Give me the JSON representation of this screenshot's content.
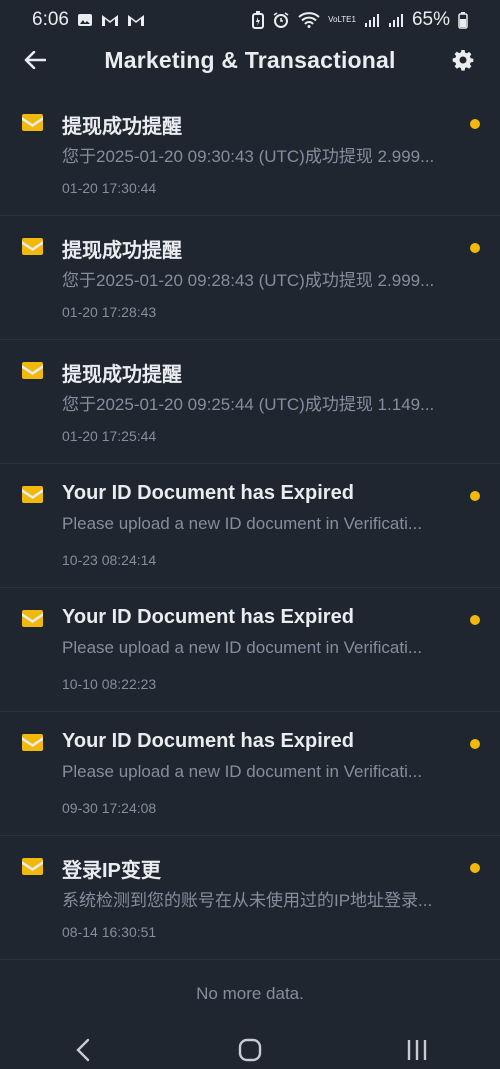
{
  "status_bar": {
    "time": "6:06",
    "battery": "65%",
    "network": "VoLTE1"
  },
  "header": {
    "title": "Marketing & Transactional"
  },
  "messages": [
    {
      "title": "提现成功提醒",
      "preview": "您于2025-01-20 09:30:43 (UTC)成功提现 2.999...",
      "time": "01-20 17:30:44",
      "unread": true
    },
    {
      "title": "提现成功提醒",
      "preview": "您于2025-01-20 09:28:43 (UTC)成功提现 2.999...",
      "time": "01-20 17:28:43",
      "unread": true
    },
    {
      "title": "提现成功提醒",
      "preview": "您于2025-01-20 09:25:44 (UTC)成功提现 1.149...",
      "time": "01-20 17:25:44",
      "unread": false
    },
    {
      "title": "Your ID Document has Expired",
      "preview": "Please upload a new ID document in Verificati...",
      "time": "10-23 08:24:14",
      "unread": true
    },
    {
      "title": "Your ID Document has Expired",
      "preview": "Please upload a new ID document in Verificati...",
      "time": "10-10 08:22:23",
      "unread": true
    },
    {
      "title": "Your ID Document has Expired",
      "preview": "Please upload a new ID document in Verificati...",
      "time": "09-30 17:24:08",
      "unread": true
    },
    {
      "title": "登录IP变更",
      "preview": "系统检测到您的账号在从未使用过的IP地址登录...",
      "time": "08-14 16:30:51",
      "unread": true
    }
  ],
  "footer": {
    "no_more": "No more data."
  },
  "colors": {
    "accent": "#f0b90b",
    "background": "#1f2630",
    "muted_text": "#848e9c"
  }
}
